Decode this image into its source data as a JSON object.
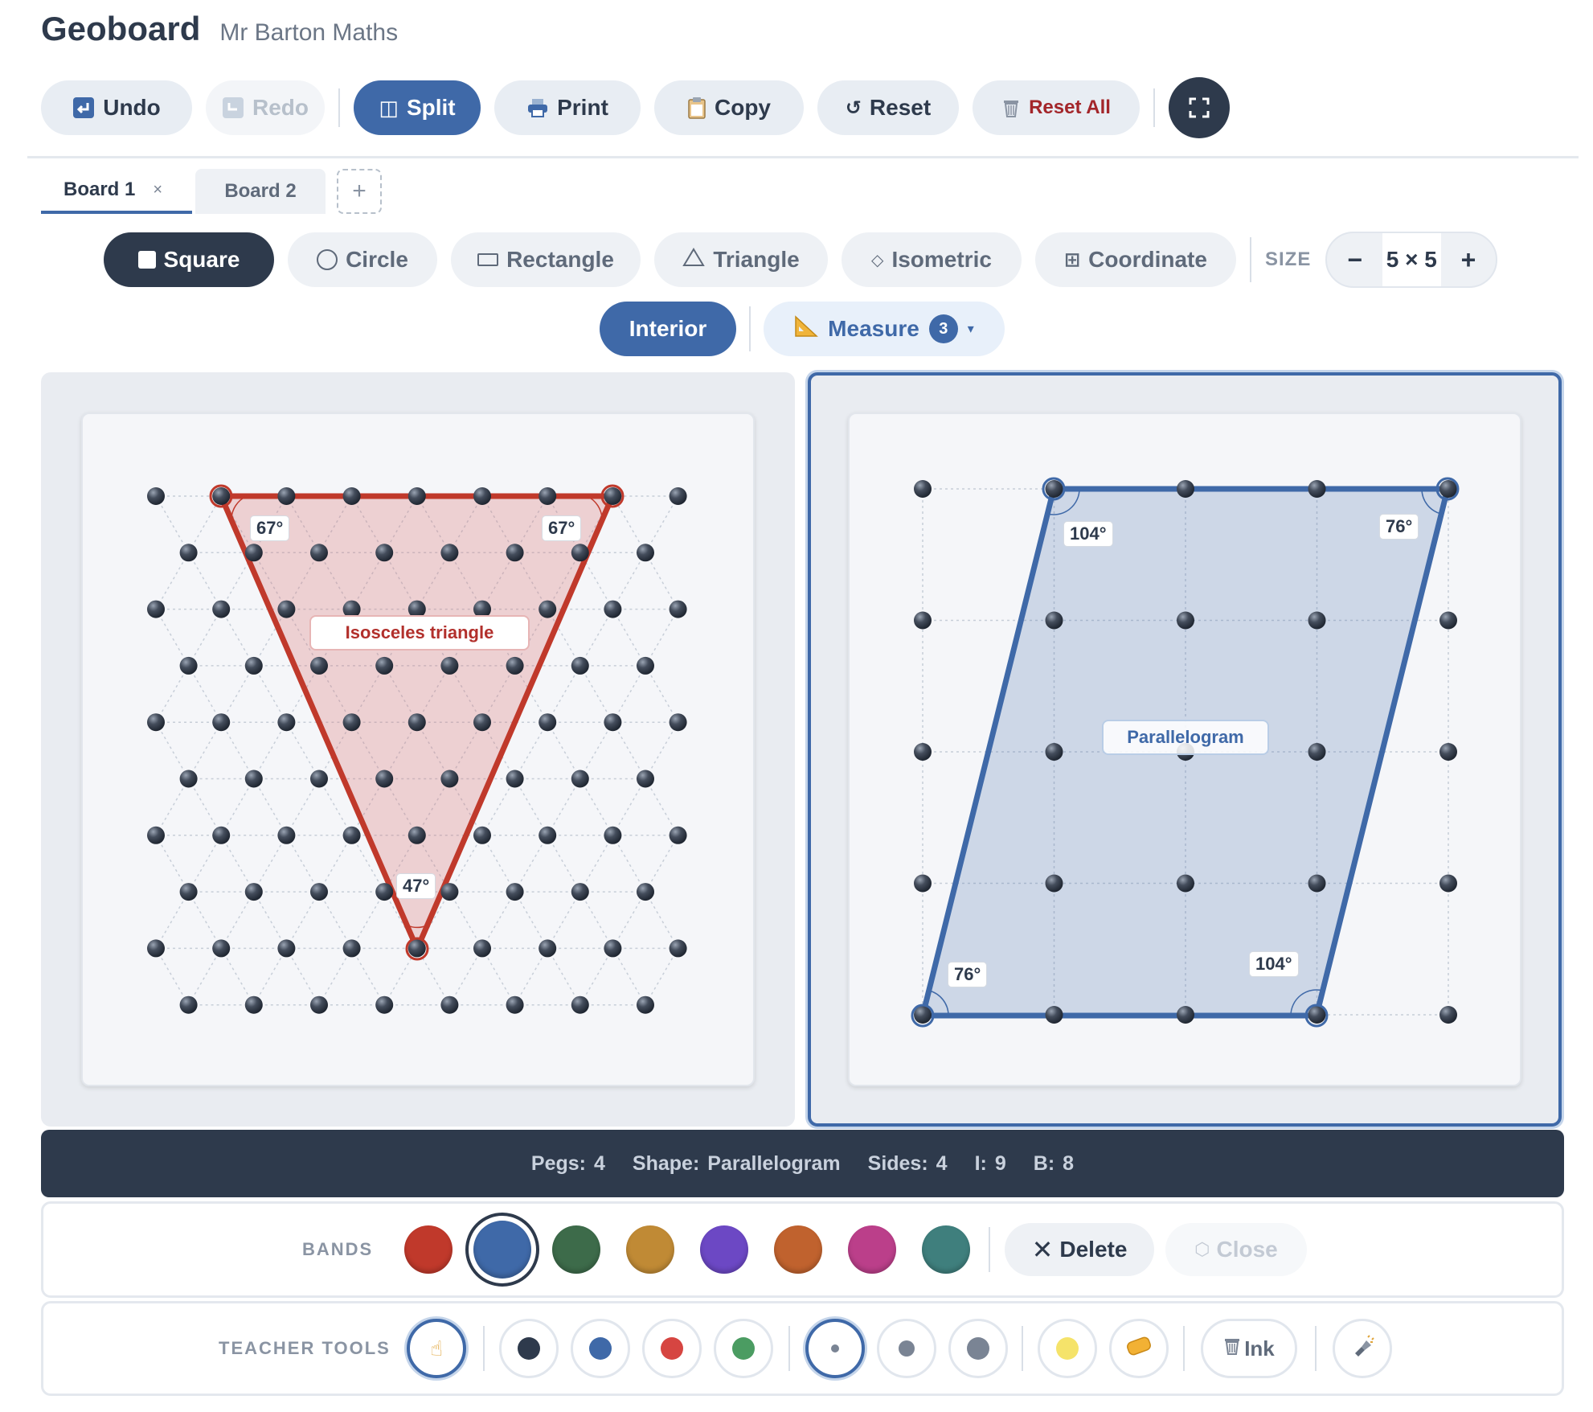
{
  "app": {
    "title": "Geoboard",
    "subtitle": "Mr Barton Maths"
  },
  "toolbar": {
    "undo": "Undo",
    "redo": "Redo",
    "split": "Split",
    "print": "Print",
    "copy": "Copy",
    "reset": "Reset",
    "reset_all": "Reset All"
  },
  "tabs": {
    "board1": "Board 1",
    "board1_close": "×",
    "board2": "Board 2",
    "add": "+"
  },
  "board_types": {
    "items": [
      "Square",
      "Circle",
      "Rectangle",
      "Triangle",
      "Isometric",
      "Coordinate"
    ],
    "selected": "Square",
    "size_label": "SIZE",
    "size_minus": "−",
    "size_value": "5 × 5",
    "size_plus": "+"
  },
  "modes": {
    "interior": "Interior",
    "measure": "Measure",
    "measure_count": "3"
  },
  "left_board": {
    "grid": "isometric",
    "shape_label": "Isosceles triangle",
    "angles": [
      "67°",
      "67°",
      "47°"
    ],
    "band_color": "#c0392b"
  },
  "right_board": {
    "grid": "square 5 × 5",
    "shape_label": "Parallelogram",
    "angles": [
      "104°",
      "76°",
      "76°",
      "104°"
    ],
    "band_color": "#3f69a8"
  },
  "status": {
    "pegs_label": "Pegs:",
    "pegs": "4",
    "shape_label": "Shape:",
    "shape": "Parallelogram",
    "sides_label": "Sides:",
    "sides": "4",
    "i_label": "I:",
    "i": "9",
    "b_label": "B:",
    "b": "8"
  },
  "bands": {
    "label": "BANDS",
    "colors": [
      "#c0392b",
      "#3f69a8",
      "#3d6b4a",
      "#c08a35",
      "#6c48c4",
      "#c0622e",
      "#bb3f8a",
      "#3f7f7d"
    ],
    "selected_index": 1,
    "delete": "Delete",
    "close": "Close"
  },
  "teacher_tools": {
    "label": "TEACHER TOOLS",
    "pen_colors": [
      "#2e3a4c",
      "#3f69a8",
      "#d64541",
      "#4b9c62"
    ],
    "highlighter": "#f5e36a",
    "ink": "Ink"
  }
}
